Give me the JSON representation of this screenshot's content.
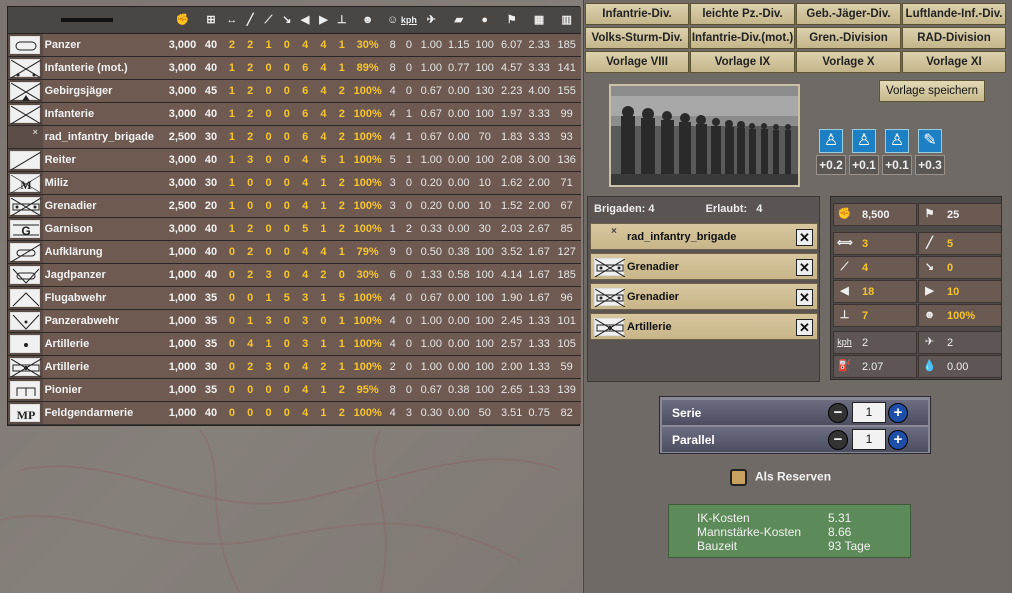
{
  "table": {
    "headers": [
      "men-icon",
      "org-icon",
      "hardness-icon",
      "soft-attack-icon",
      "hard-attack-icon",
      "air-attack-icon",
      "defense-icon",
      "toughness-icon",
      "air-defense-icon",
      "supply-icon",
      "morale-icon",
      "speed-icon",
      "air-icon",
      "fuel-icon",
      "consumption-icon",
      "transport-icon",
      "flag-icon",
      "factory-icon",
      "officer-icon",
      "clock-icon"
    ],
    "speed_header": "kph",
    "rows": [
      {
        "name": "Panzer",
        "symbol": "panzer",
        "v": [
          "3,000",
          "40",
          "2",
          "2",
          "1",
          "0",
          "4",
          "4",
          "1",
          "30%",
          "8",
          "0",
          "1.00",
          "1.15",
          "100",
          "6.07",
          "2.33",
          "185"
        ]
      },
      {
        "name": "Infanterie (mot.)",
        "symbol": "inf-mot",
        "v": [
          "3,000",
          "40",
          "1",
          "2",
          "0",
          "0",
          "6",
          "4",
          "1",
          "89%",
          "8",
          "0",
          "1.00",
          "0.77",
          "100",
          "4.57",
          "3.33",
          "141"
        ]
      },
      {
        "name": "Gebirgsjäger",
        "symbol": "mountain",
        "v": [
          "3,000",
          "45",
          "1",
          "2",
          "0",
          "0",
          "6",
          "4",
          "2",
          "100%",
          "4",
          "0",
          "0.67",
          "0.00",
          "130",
          "2.23",
          "4.00",
          "155"
        ]
      },
      {
        "name": "Infanterie",
        "symbol": "infantry",
        "v": [
          "3,000",
          "40",
          "1",
          "2",
          "0",
          "0",
          "6",
          "4",
          "2",
          "100%",
          "4",
          "1",
          "0.67",
          "0.00",
          "100",
          "1.97",
          "3.33",
          "99"
        ]
      },
      {
        "name": "rad_infantry_brigade",
        "symbol": "none",
        "v": [
          "2,500",
          "30",
          "1",
          "2",
          "0",
          "0",
          "6",
          "4",
          "2",
          "100%",
          "4",
          "1",
          "0.67",
          "0.00",
          "70",
          "1.83",
          "3.33",
          "93"
        ]
      },
      {
        "name": "Reiter",
        "symbol": "cavalry",
        "v": [
          "3,000",
          "40",
          "1",
          "3",
          "0",
          "0",
          "4",
          "5",
          "1",
          "100%",
          "5",
          "1",
          "1.00",
          "0.00",
          "100",
          "2.08",
          "3.00",
          "136"
        ]
      },
      {
        "name": "Miliz",
        "symbol": "militia",
        "v": [
          "3,000",
          "30",
          "1",
          "0",
          "0",
          "0",
          "4",
          "1",
          "2",
          "100%",
          "3",
          "0",
          "0.20",
          "0.00",
          "10",
          "1.62",
          "2.00",
          "71"
        ]
      },
      {
        "name": "Grenadier",
        "symbol": "grenadier",
        "v": [
          "2,500",
          "20",
          "1",
          "0",
          "0",
          "0",
          "4",
          "1",
          "2",
          "100%",
          "3",
          "0",
          "0.20",
          "0.00",
          "10",
          "1.52",
          "2.00",
          "67"
        ]
      },
      {
        "name": "Garnison",
        "symbol": "garrison",
        "v": [
          "3,000",
          "40",
          "1",
          "2",
          "0",
          "0",
          "5",
          "1",
          "2",
          "100%",
          "1",
          "2",
          "0.33",
          "0.00",
          "30",
          "2.03",
          "2.67",
          "85"
        ]
      },
      {
        "name": "Aufklärung",
        "symbol": "recon",
        "v": [
          "1,000",
          "40",
          "0",
          "2",
          "0",
          "0",
          "4",
          "4",
          "1",
          "79%",
          "9",
          "0",
          "0.50",
          "0.38",
          "100",
          "3.52",
          "1.67",
          "127"
        ]
      },
      {
        "name": "Jagdpanzer",
        "symbol": "td",
        "v": [
          "1,000",
          "40",
          "0",
          "2",
          "3",
          "0",
          "4",
          "2",
          "0",
          "30%",
          "6",
          "0",
          "1.33",
          "0.58",
          "100",
          "4.14",
          "1.67",
          "185"
        ]
      },
      {
        "name": "Flugabwehr",
        "symbol": "aa",
        "v": [
          "1,000",
          "35",
          "0",
          "0",
          "1",
          "5",
          "3",
          "1",
          "5",
          "100%",
          "4",
          "0",
          "0.67",
          "0.00",
          "100",
          "1.90",
          "1.67",
          "96"
        ]
      },
      {
        "name": "Panzerabwehr",
        "symbol": "at",
        "v": [
          "1,000",
          "35",
          "0",
          "1",
          "3",
          "0",
          "3",
          "0",
          "1",
          "100%",
          "4",
          "0",
          "1.00",
          "0.00",
          "100",
          "2.45",
          "1.33",
          "101"
        ]
      },
      {
        "name": "Artillerie",
        "symbol": "art-dot",
        "v": [
          "1,000",
          "35",
          "0",
          "4",
          "1",
          "0",
          "3",
          "1",
          "1",
          "100%",
          "4",
          "0",
          "1.00",
          "0.00",
          "100",
          "2.57",
          "1.33",
          "105"
        ]
      },
      {
        "name": "Artillerie",
        "symbol": "art",
        "v": [
          "1,000",
          "30",
          "0",
          "2",
          "3",
          "0",
          "4",
          "2",
          "1",
          "100%",
          "2",
          "0",
          "1.00",
          "0.00",
          "100",
          "2.00",
          "1.33",
          "59"
        ]
      },
      {
        "name": "Pionier",
        "symbol": "engineer",
        "v": [
          "1,000",
          "35",
          "0",
          "0",
          "0",
          "0",
          "4",
          "1",
          "2",
          "95%",
          "8",
          "0",
          "0.67",
          "0.38",
          "100",
          "2.65",
          "1.33",
          "139"
        ]
      },
      {
        "name": "Feldgendarmerie",
        "symbol": "mp",
        "v": [
          "1,000",
          "40",
          "0",
          "0",
          "0",
          "0",
          "4",
          "1",
          "2",
          "100%",
          "4",
          "3",
          "0.30",
          "0.00",
          "50",
          "3.51",
          "0.75",
          "82"
        ]
      }
    ]
  },
  "templates": {
    "row1": [
      "Infantrie-Div.",
      "leichte Pz.-Div.",
      "Geb.-Jäger-Div.",
      "Luftlande-Inf.-Div."
    ],
    "row2": [
      "Volks-Sturm-Div.",
      "Infantrie-Div.(mot.)",
      "Gren.-Division",
      "RAD-Division"
    ],
    "row3": [
      "Vorlage VIII",
      "Vorlage IX",
      "Vorlage X",
      "Vorlage XI"
    ]
  },
  "save_label": "Vorlage speichern",
  "minister_bonuses": [
    "+0.2",
    "+0.1",
    "+0.1",
    "+0.3"
  ],
  "brigades": {
    "label": "Brigaden:",
    "count": "4",
    "allowed_label": "Erlaubt:",
    "allowed": "4",
    "items": [
      {
        "name": "rad_infantry_brigade",
        "symbol": "none"
      },
      {
        "name": "Grenadier",
        "symbol": "grenadier"
      },
      {
        "name": "Grenadier",
        "symbol": "grenadier"
      },
      {
        "name": "Artillerie",
        "symbol": "art"
      }
    ],
    "remove_glyph": "✕"
  },
  "stats": {
    "men": "8,500",
    "org": "25",
    "soft_attack": "3",
    "hard_attack": "5",
    "air_attack": "4",
    "defense": "0",
    "toughness": "18",
    "air_defense": "10",
    "supply": "7",
    "morale": "100%",
    "speed": "2",
    "air": "2",
    "fuel": "2.07",
    "consumption": "0.00",
    "kph_label": "kph"
  },
  "production": {
    "serie_label": "Serie",
    "serie_value": "1",
    "parallel_label": "Parallel",
    "parallel_value": "1",
    "minus": "−",
    "plus": "+"
  },
  "reserve_label": "Als Reserven",
  "costs": {
    "ic_label": "IK-Kosten",
    "ic": "5.31",
    "mp_label": "Mannstärke-Kosten",
    "mp": "8.66",
    "time_label": "Bauzeit",
    "time": "93 Tage"
  },
  "colors": {
    "highlight": "#f5c430",
    "panel_brown": "#6e5a51",
    "button_tan": "#c8b589",
    "cost_green": "#5c8a58"
  }
}
